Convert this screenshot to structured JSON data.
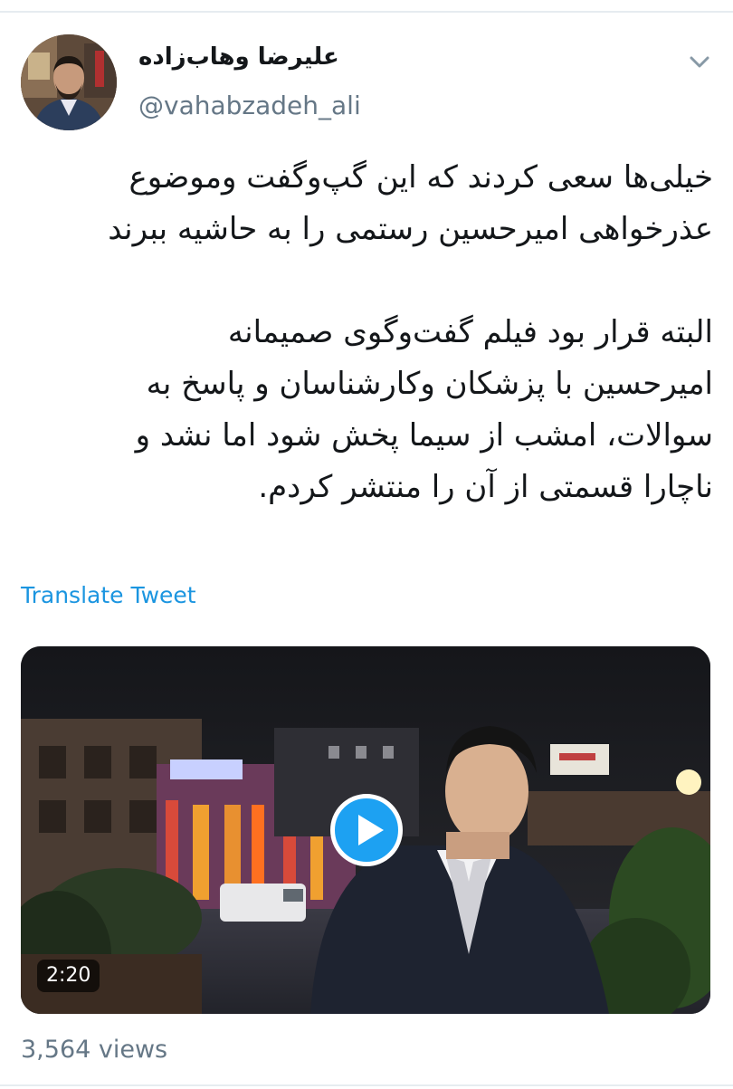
{
  "author": {
    "name": "علیرضا وهاب‌زاده",
    "handle": "@vahabzadeh_ali"
  },
  "tweet": {
    "paragraph1_line1": "خیلی‌ها سعی کردند که این گپ‌وگفت وموضوع",
    "paragraph1_line2": "عذرخواهی امیرحسین رستمی را به حاشیه ببرند",
    "paragraph2_line1": "البته قرار بود فیلم گفت‌وگوی صمیمانه",
    "paragraph2_line2": "امیرحسین با پزشکان وکارشناسان و پاسخ به",
    "paragraph2_line3": "سوالات، امشب از سیما پخش شود اما نشد و",
    "paragraph2_line4": "ناچارا قسمتی از آن را منتشر کردم."
  },
  "translate_label": "Translate Tweet",
  "media": {
    "duration": "2:20",
    "play_icon": "play-icon"
  },
  "views_label": "3,564 views",
  "colors": {
    "link": "#1b95e0",
    "accent": "#1da1f2",
    "secondary_text": "#657786",
    "primary_text": "#14171a"
  },
  "icons": {
    "caret": "chevron-down-icon"
  }
}
